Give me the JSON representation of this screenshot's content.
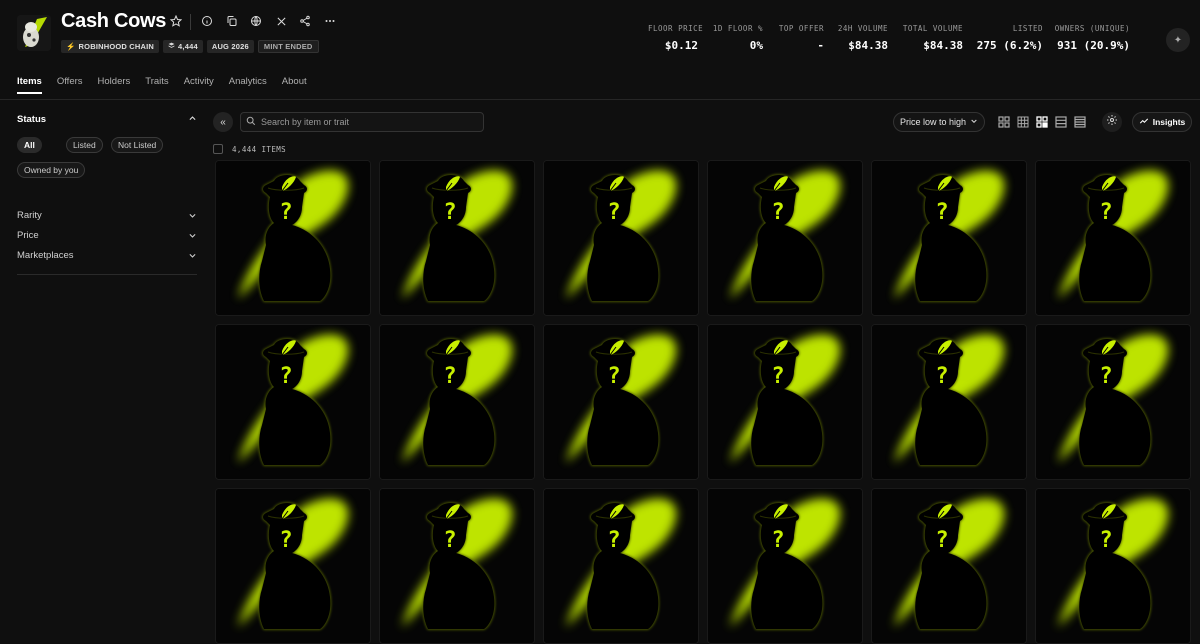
{
  "collection": {
    "title": "Cash Cows",
    "chips": [
      {
        "icon": "lightning-icon",
        "label": "ROBINHOOD CHAIN"
      },
      {
        "icon": "layers-icon",
        "label": "4,444"
      },
      {
        "label": "AUG 2026"
      },
      {
        "label": "MINT ENDED"
      }
    ]
  },
  "stats": [
    {
      "label": "FLOOR PRICE",
      "value": "$0.12"
    },
    {
      "label": "1D FLOOR %",
      "value": "0%"
    },
    {
      "label": "TOP OFFER",
      "value": "-"
    },
    {
      "label": "24H VOLUME",
      "value": "$84.38"
    },
    {
      "label": "TOTAL VOLUME",
      "value": "$84.38"
    },
    {
      "label": "LISTED",
      "value": "275 (6.2%)"
    },
    {
      "label": "OWNERS (UNIQUE)",
      "value": "931 (20.9%)"
    }
  ],
  "tabs": [
    "Items",
    "Offers",
    "Holders",
    "Traits",
    "Activity",
    "Analytics",
    "About"
  ],
  "sidebar": {
    "status_title": "Status",
    "status_options": [
      "All",
      "Listed",
      "Not Listed",
      "Owned by you"
    ],
    "filters": [
      "Rarity",
      "Price",
      "Marketplaces"
    ]
  },
  "toolbar": {
    "search_placeholder": "Search by item or trait",
    "sort_label": "Price low to high",
    "insights_label": "Insights",
    "item_count": "4,444 ITEMS"
  },
  "colors": {
    "accent": "#c8f000",
    "background": "#0f0f0f"
  },
  "grid": {
    "rows": 3,
    "columns": 6,
    "item_image": "unrevealed-cow-silhouette"
  }
}
